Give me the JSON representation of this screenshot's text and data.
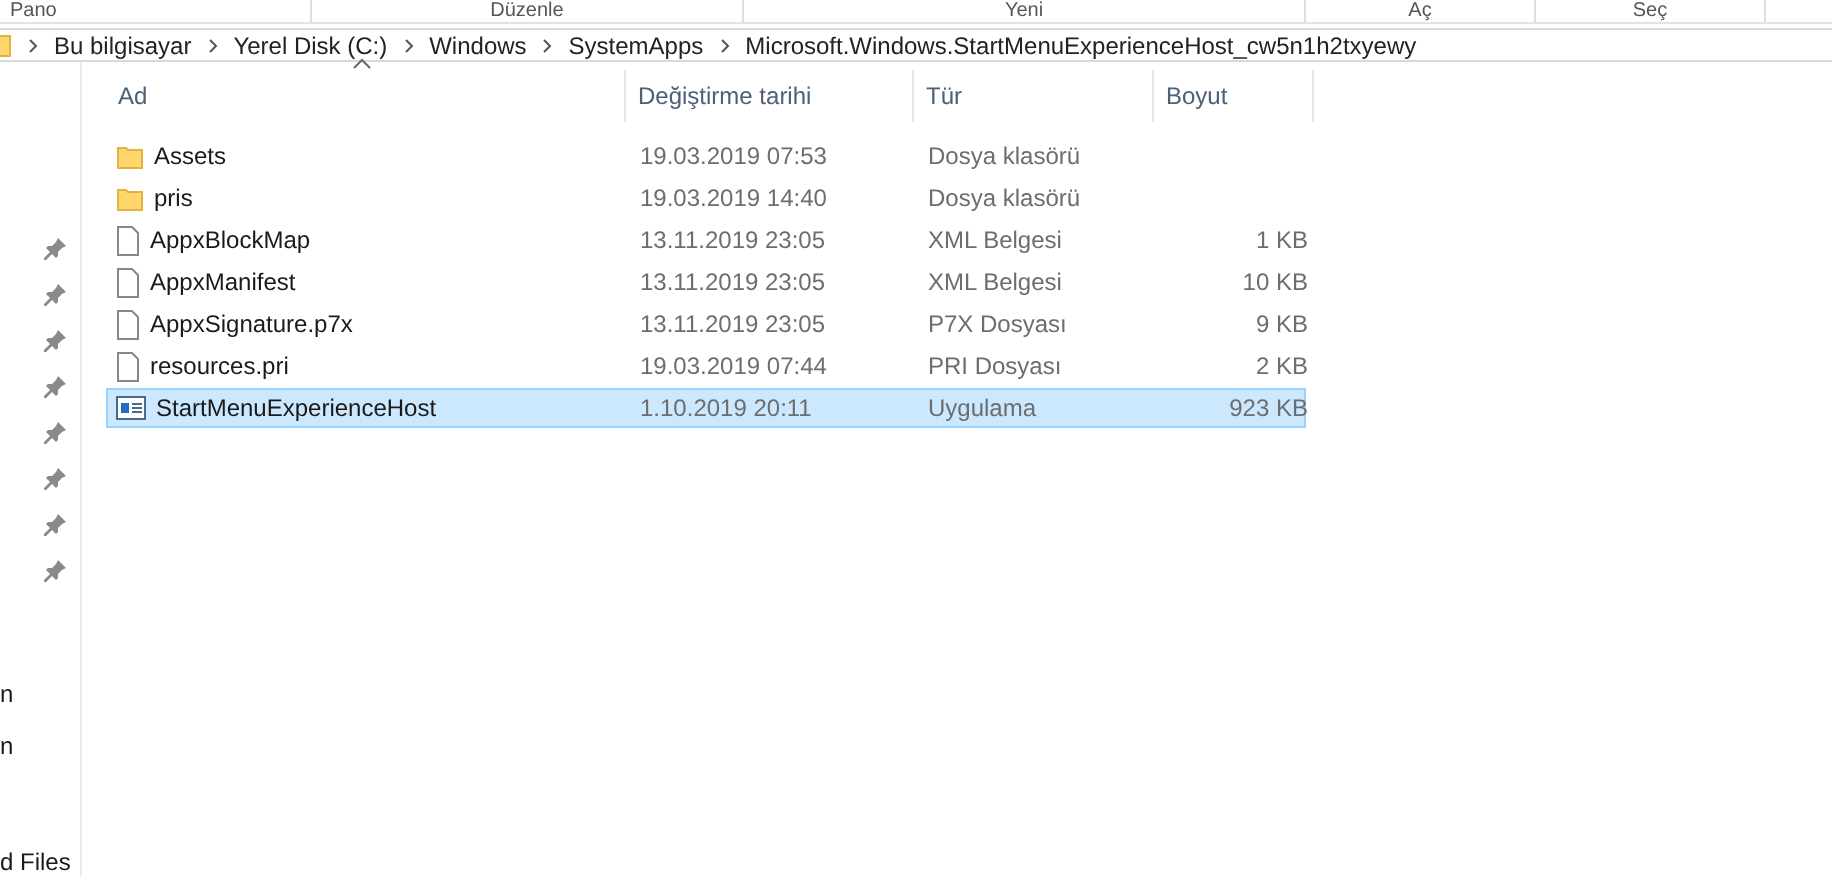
{
  "ribbon_groups": [
    "Pano",
    "Düzenle",
    "Yeni",
    "Aç",
    "Seç"
  ],
  "breadcrumb": [
    "Bu bilgisayar",
    "Yerel Disk (C:)",
    "Windows",
    "SystemApps",
    "Microsoft.Windows.StartMenuExperienceHost_cw5n1h2txyewy"
  ],
  "nav_pane": {
    "items": [
      "n",
      "n",
      "d Files"
    ]
  },
  "table": {
    "columns": [
      "Ad",
      "Değiştirme tarihi",
      "Tür",
      "Boyut"
    ],
    "rows": [
      {
        "kind": "folder",
        "name": "Assets",
        "date": "19.03.2019 07:53",
        "type": "Dosya klasörü",
        "size": "",
        "selected": false
      },
      {
        "kind": "folder",
        "name": "pris",
        "date": "19.03.2019 14:40",
        "type": "Dosya klasörü",
        "size": "",
        "selected": false
      },
      {
        "kind": "file",
        "name": "AppxBlockMap",
        "date": "13.11.2019 23:05",
        "type": "XML Belgesi",
        "size": "1 KB",
        "selected": false
      },
      {
        "kind": "file",
        "name": "AppxManifest",
        "date": "13.11.2019 23:05",
        "type": "XML Belgesi",
        "size": "10 KB",
        "selected": false
      },
      {
        "kind": "file",
        "name": "AppxSignature.p7x",
        "date": "13.11.2019 23:05",
        "type": "P7X Dosyası",
        "size": "9 KB",
        "selected": false
      },
      {
        "kind": "file",
        "name": "resources.pri",
        "date": "19.03.2019 07:44",
        "type": "PRI Dosyası",
        "size": "2 KB",
        "selected": false
      },
      {
        "kind": "app",
        "name": "StartMenuExperienceHost",
        "date": "1.10.2019 20:11",
        "type": "Uygulama",
        "size": "923 KB",
        "selected": true
      }
    ]
  }
}
